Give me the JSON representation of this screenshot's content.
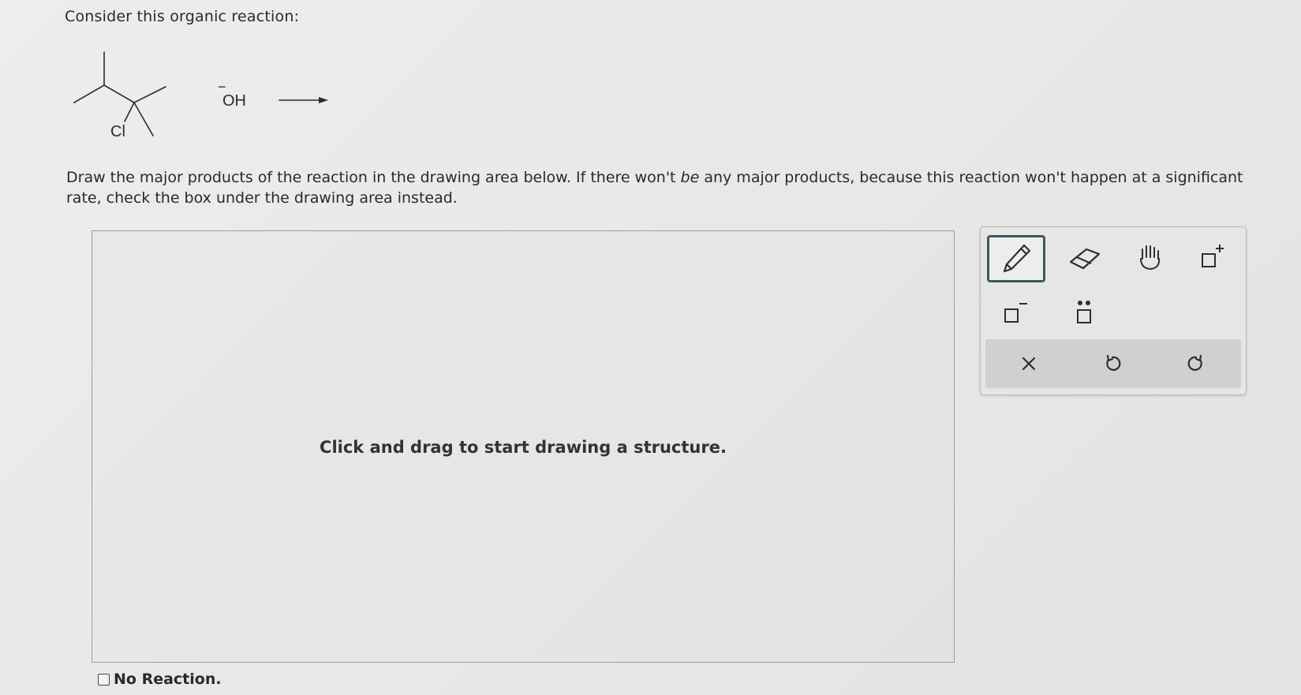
{
  "question": {
    "prompt": "Consider this organic reaction:",
    "instructions_part1": "Draw the major products of the reaction in the drawing area below. If there won't ",
    "instructions_emphasis": "be",
    "instructions_part2": " any major products, because this reaction won't happen at a significant rate, check the box under the drawing area instead."
  },
  "reaction": {
    "substituent_label": "Cl",
    "reagent_label": "OH",
    "reagent_charge": "−"
  },
  "drawing_area": {
    "hint": "Click and drag to start drawing a structure."
  },
  "toolbar": {
    "tools": [
      "pencil-icon",
      "eraser-icon",
      "hand-icon",
      "positive-charge-icon",
      "negative-charge-icon",
      "lone-pair-icon"
    ],
    "selected_tool": "pencil-icon",
    "actions": [
      "clear-icon",
      "undo-icon",
      "redo-icon"
    ]
  },
  "no_reaction": {
    "label": "No Reaction.",
    "checked": false
  }
}
